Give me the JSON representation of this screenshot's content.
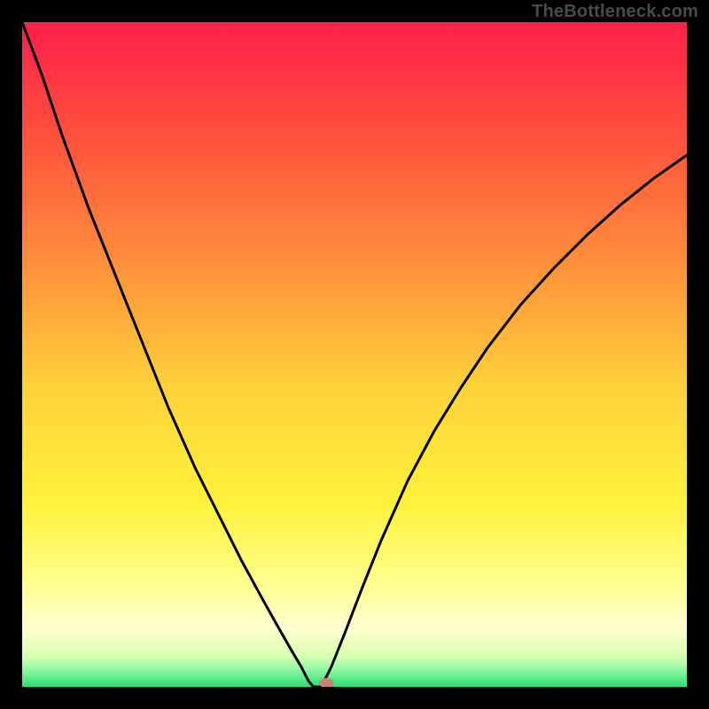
{
  "watermark": "TheBottleneck.com",
  "colors": {
    "page_bg": "#000000",
    "curve": "#000000",
    "marker": "#cc7f74",
    "gradient_stops": [
      {
        "offset": 0.0,
        "color": "#ff1f4b"
      },
      {
        "offset": 0.15,
        "color": "#ff4a3f"
      },
      {
        "offset": 0.35,
        "color": "#ff8b3a"
      },
      {
        "offset": 0.55,
        "color": "#ffd23a"
      },
      {
        "offset": 0.72,
        "color": "#fff13a"
      },
      {
        "offset": 0.84,
        "color": "#ffff8a"
      },
      {
        "offset": 0.91,
        "color": "#ffffd0"
      },
      {
        "offset": 0.955,
        "color": "#d8ffb0"
      },
      {
        "offset": 0.975,
        "color": "#8cf7a0"
      },
      {
        "offset": 1.0,
        "color": "#27e076"
      }
    ]
  },
  "chart_data": {
    "type": "line",
    "title": "",
    "xlabel": "",
    "ylabel": "",
    "xlim": [
      0,
      100
    ],
    "ylim": [
      0,
      100
    ],
    "note": "x and y are normalized 0–100 across the inner plot box; y=0 is the top edge, y=100 the bottom edge (as drawn). Values are read from the rendered curve in the image.",
    "series": [
      {
        "name": "bottleneck-curve",
        "x": [
          0.0,
          3.0,
          6.0,
          10.0,
          14.0,
          18.0,
          22.0,
          26.0,
          30.0,
          33.0,
          36.0,
          38.5,
          40.5,
          42.0,
          43.0,
          43.8,
          45.0,
          46.5,
          48.5,
          51.0,
          54.0,
          58.0,
          62.0,
          66.0,
          70.0,
          75.0,
          80.0,
          85.0,
          90.0,
          95.0,
          100.0
        ],
        "y": [
          0.0,
          8.0,
          17.0,
          28.0,
          38.0,
          48.0,
          58.0,
          67.0,
          75.0,
          81.0,
          86.5,
          91.0,
          94.5,
          97.0,
          99.0,
          100.0,
          100.0,
          97.0,
          92.0,
          85.5,
          78.0,
          69.0,
          61.5,
          55.0,
          49.0,
          42.5,
          37.0,
          32.0,
          27.5,
          23.5,
          20.0
        ]
      }
    ],
    "marker": {
      "x": 45.8,
      "y": 100.0
    },
    "left_start": {
      "x_at_top": 5.0
    }
  }
}
